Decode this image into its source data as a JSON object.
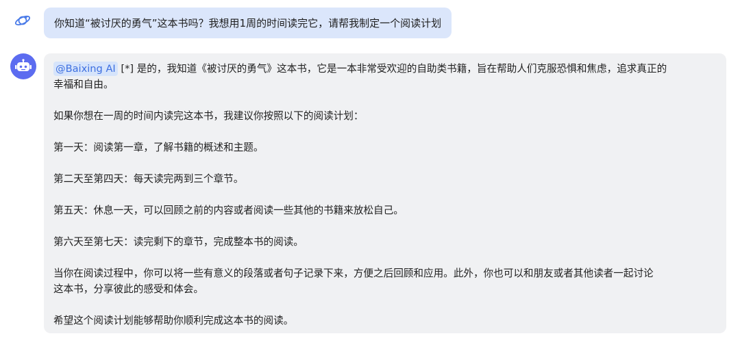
{
  "user_message": {
    "avatar_icon": "planet-logo-icon",
    "text": "你知道“被讨厌的勇气”这本书吗？我想用1周的时间读完它，请帮我制定一个阅读计划"
  },
  "bot_message": {
    "avatar_icon": "robot-icon",
    "mention": "@Baixing AI",
    "intro_line1": " [*] 是的，我知道《被讨厌的勇气》这本书，它是一本非常受欢迎的自助类书籍，旨在帮助人们克服恐惧和焦虑，追求真正的",
    "intro_line2": "幸福和自由。",
    "plan_intro": "如果你想在一周的时间内读完这本书，我建议你按照以下的阅读计划：",
    "day1": "第一天：阅读第一章，了解书籍的概述和主题。",
    "day2_4": "第二天至第四天：每天读完两到三个章节。",
    "day5": "第五天：休息一天，可以回顾之前的内容或者阅读一些其他的书籍来放松自己。",
    "day6_7": "第六天至第七天：读完剩下的章节，完成整本书的阅读。",
    "tips_line1": "当你在阅读过程中，你可以将一些有意义的段落或者句子记录下来，方便之后回顾和应用。此外，你也可以和朋友或者其他读者一起讨论",
    "tips_line2": "这本书，分享彼此的感受和体会。",
    "closing": "希望这个阅读计划能够帮助你顺利完成这本书的阅读。"
  },
  "colors": {
    "user_bubble": "#dbe6fb",
    "bot_bubble": "#f0f1f3",
    "bot_avatar": "#5c6cf0",
    "mention_text": "#3d6fe0",
    "mention_bg": "#d6e4fb"
  }
}
